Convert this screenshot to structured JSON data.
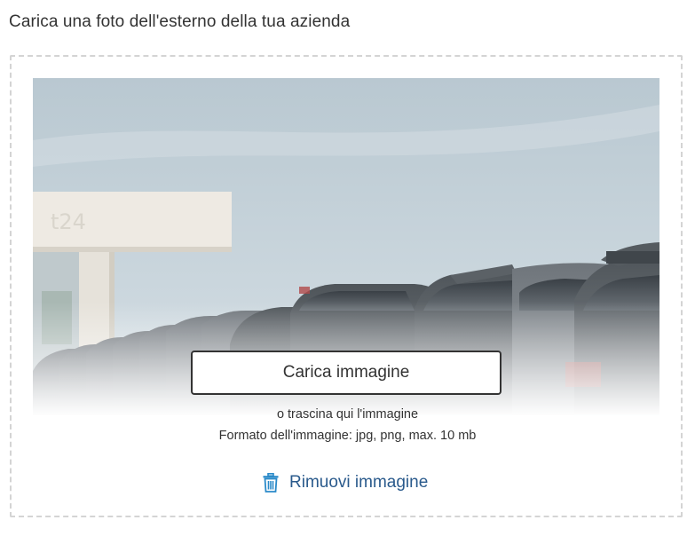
{
  "page": {
    "title": "Carica una foto dell'esterno della tua azienda"
  },
  "uploader": {
    "upload_button_label": "Carica immagine",
    "drag_hint": "o trascina qui l'immagine",
    "format_hint": "Formato dell'immagine: jpg, png, max. 10 mb",
    "remove_label": "Rimuovi immagine",
    "remove_icon": "trash-icon",
    "preview_sign_text": "t24"
  },
  "colors": {
    "link": "#2a5a8c",
    "button_border": "#333333",
    "dashed_border": "#d4d4d4"
  }
}
